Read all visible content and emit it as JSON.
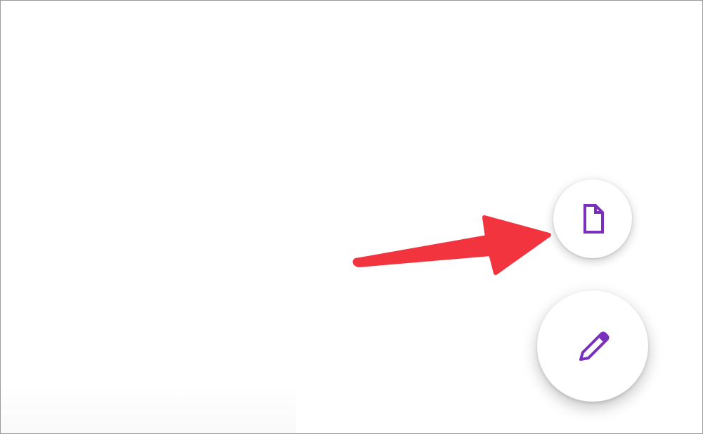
{
  "colors": {
    "background": "#ffffff",
    "fab_background": "#ffffff",
    "icon_accent": "#7b2fbe",
    "annotation_arrow": "#f2343f"
  },
  "fabs": {
    "new_document": {
      "icon": "document-icon"
    },
    "compose": {
      "icon": "pencil-icon"
    }
  },
  "annotation": {
    "icon": "arrow-icon"
  }
}
